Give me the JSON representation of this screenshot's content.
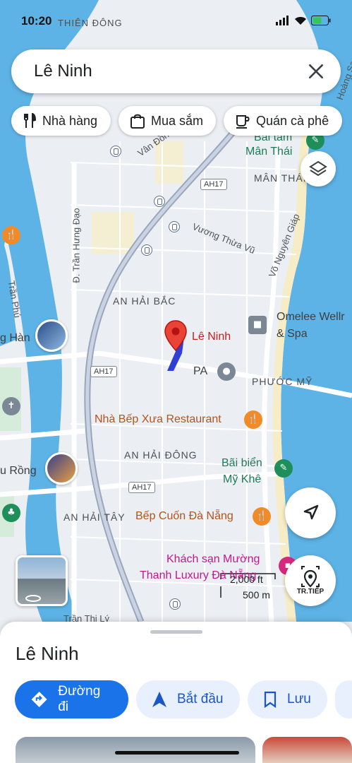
{
  "status_bar": {
    "time": "10:20",
    "overlap_text": "THIÊN ĐÔNG"
  },
  "search": {
    "query": "Lê Ninh"
  },
  "chips": [
    {
      "label": "Nhà hàng",
      "icon": "restaurant-icon"
    },
    {
      "label": "Mua sắm",
      "icon": "shopping-bag-icon"
    },
    {
      "label": "Quán cà phê",
      "icon": "coffee-icon"
    }
  ],
  "map": {
    "selected_place": "Lê Ninh",
    "areas": [
      "AN HẢI BẮC",
      "AN HẢI ĐÔNG",
      "AN HẢI TÂY",
      "PHƯỚC MỸ",
      "MÂN THÁI"
    ],
    "streets": [
      "Vân Đồn",
      "Vương Thừa Vũ",
      "Võ Nguyên Giáp",
      "Đ. Trần Hưng Đạo",
      "Trần Phú",
      "Trần Thị Lý",
      "Hoàng Sa"
    ],
    "route_shields": [
      "AH17",
      "AH17",
      "AH17"
    ],
    "pois": {
      "beach_man_thai_1": "Bãi tắm",
      "beach_man_thai_2": "Mân Thái",
      "omelee_1": "Omelee Wellr",
      "omelee_2": "& Spa",
      "spa_partial": "PA",
      "nha_bep_xua": "Nhà Bếp Xưa Restaurant",
      "my_khe_1": "Bãi biển",
      "my_khe_2": "Mỹ Khê",
      "banh_cuon": "Bếp Cuốn Đà Nẵng",
      "muong_thanh_1": "Khách sạn Mường",
      "muong_thanh_2": "Thanh Luxury Đà Nẵng",
      "song_han": "g Hàn",
      "cau_rong": "u Rồng"
    },
    "scale": {
      "ft": "2,000 ft",
      "m": "500 m"
    },
    "directions_label": "TR.TIẾP"
  },
  "sheet": {
    "title": "Lê Ninh",
    "actions": [
      {
        "label": "Đường đi",
        "icon": "directions-icon"
      },
      {
        "label": "Bắt đầu",
        "icon": "navigation-arrow-icon"
      },
      {
        "label": "Lưu",
        "icon": "bookmark-icon"
      }
    ]
  },
  "colors": {
    "water": "#5db3e6",
    "land": "#ebeef2",
    "accent": "#1a73e8",
    "pin": "#ea4335"
  }
}
